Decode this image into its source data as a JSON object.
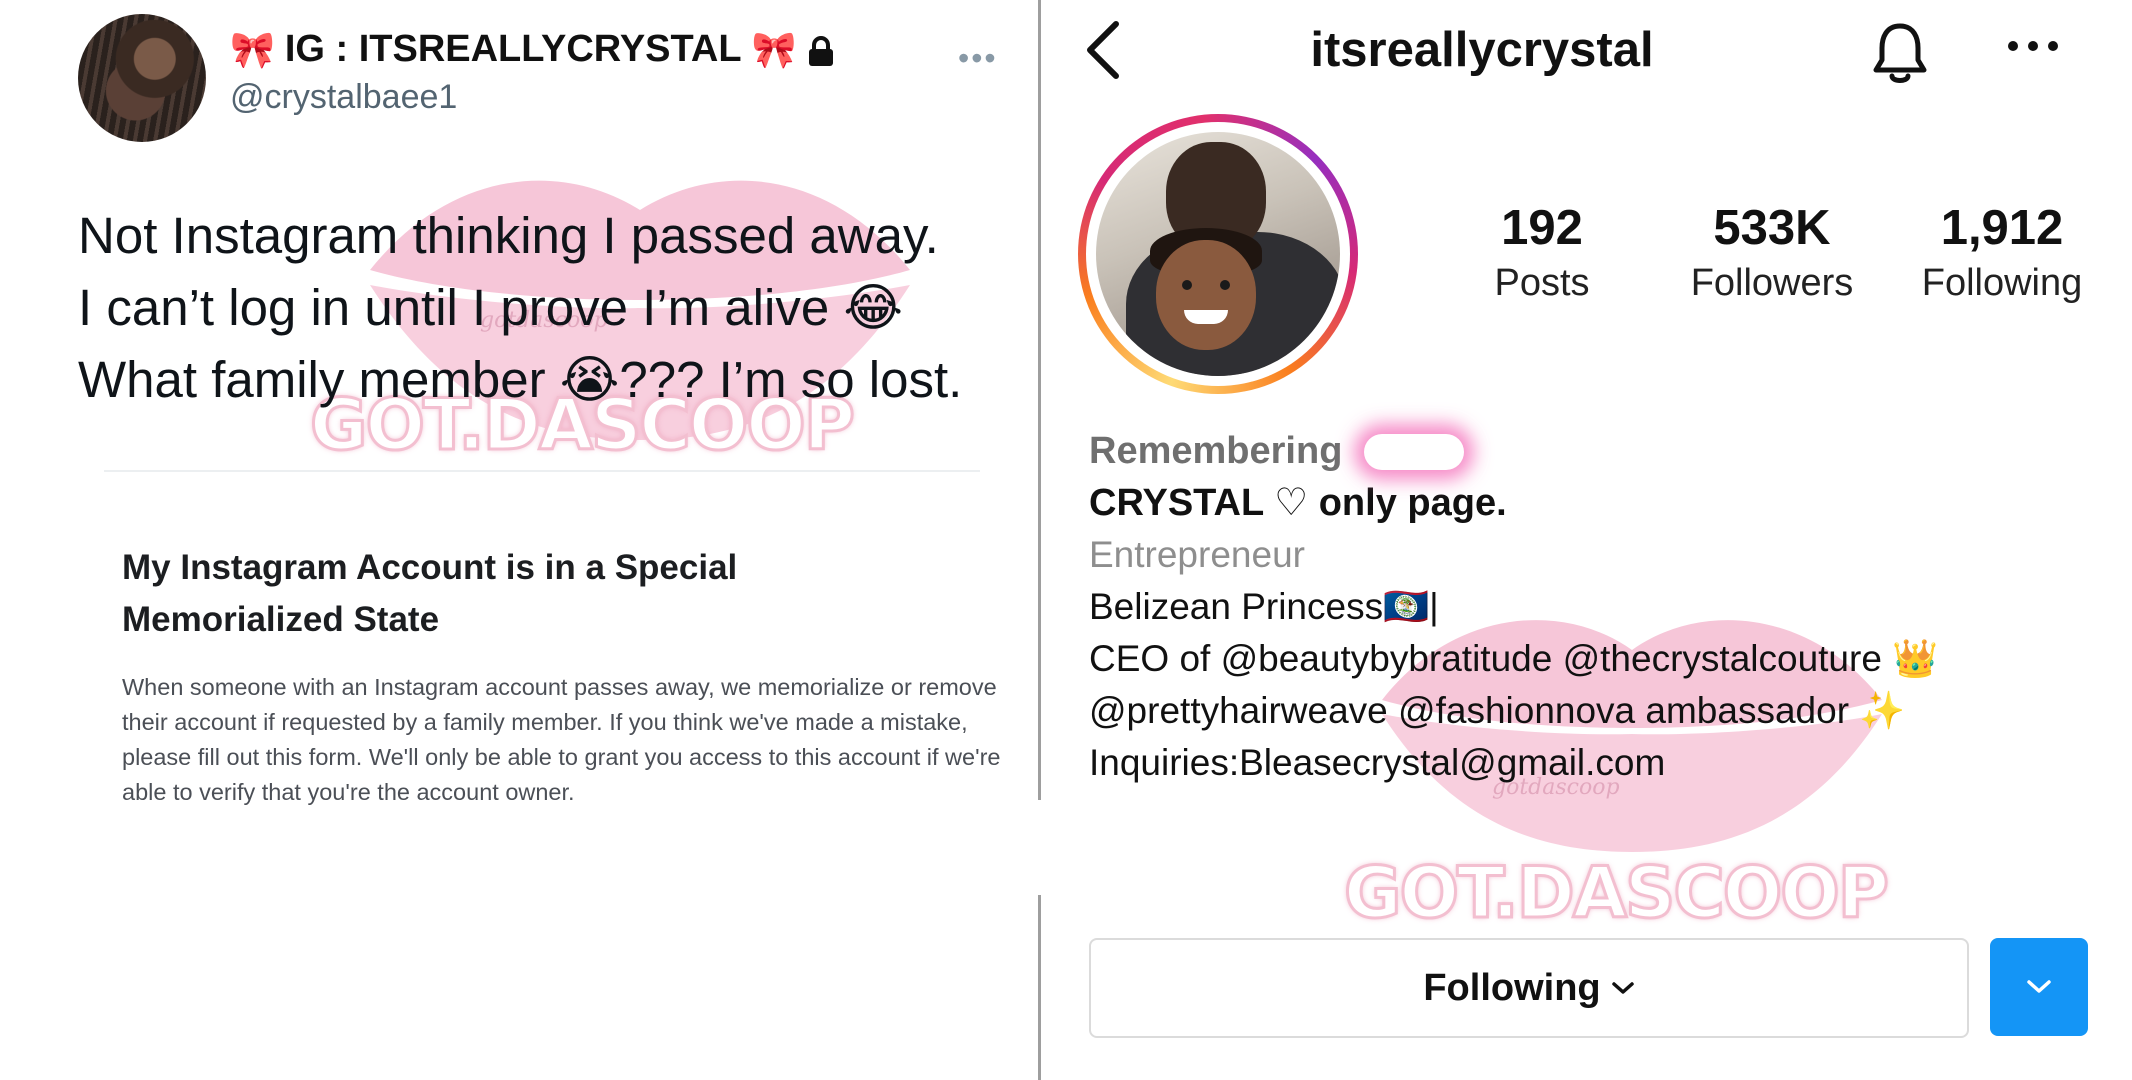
{
  "watermark": {
    "text": "GOT.DASCOOP",
    "script": "gotdascoop"
  },
  "tweet": {
    "display_name": "IG : ITSREALLYCRYSTAL",
    "handle": "@crystalbaee1",
    "text_lines": [
      "Not Instagram thinking I passed away.",
      "I can’t log in until I prove I’m alive 😂",
      "What family member 😭??? I’m so lost."
    ],
    "card_title": "My Instagram Account is in a Special Memorialized State",
    "card_body": "When someone with an Instagram account passes away, we memorialize or remove their account if requested by a family member. If you think we've made a mistake, please fill out this form. We'll only be able to grant you access to this account if we're able to verify that you're the account owner."
  },
  "instagram": {
    "username": "itsreallycrystal",
    "stats": [
      {
        "value": "192",
        "label": "Posts"
      },
      {
        "value": "533K",
        "label": "Followers"
      },
      {
        "value": "1,912",
        "label": "Following"
      }
    ],
    "memorial_label": "Remembering",
    "bio_name": "CRYSTAL ♡ only page.",
    "category": "Entrepreneur",
    "bio_lines": [
      "Belizean Princess🇧🇿|",
      "CEO of @beautybybratitude @thecrystalcouture 👑",
      "@prettyhairweave @fashionnova ambassador ✨",
      "Inquiries:Bleasecrystal@gmail.com"
    ],
    "following_button": "Following"
  }
}
